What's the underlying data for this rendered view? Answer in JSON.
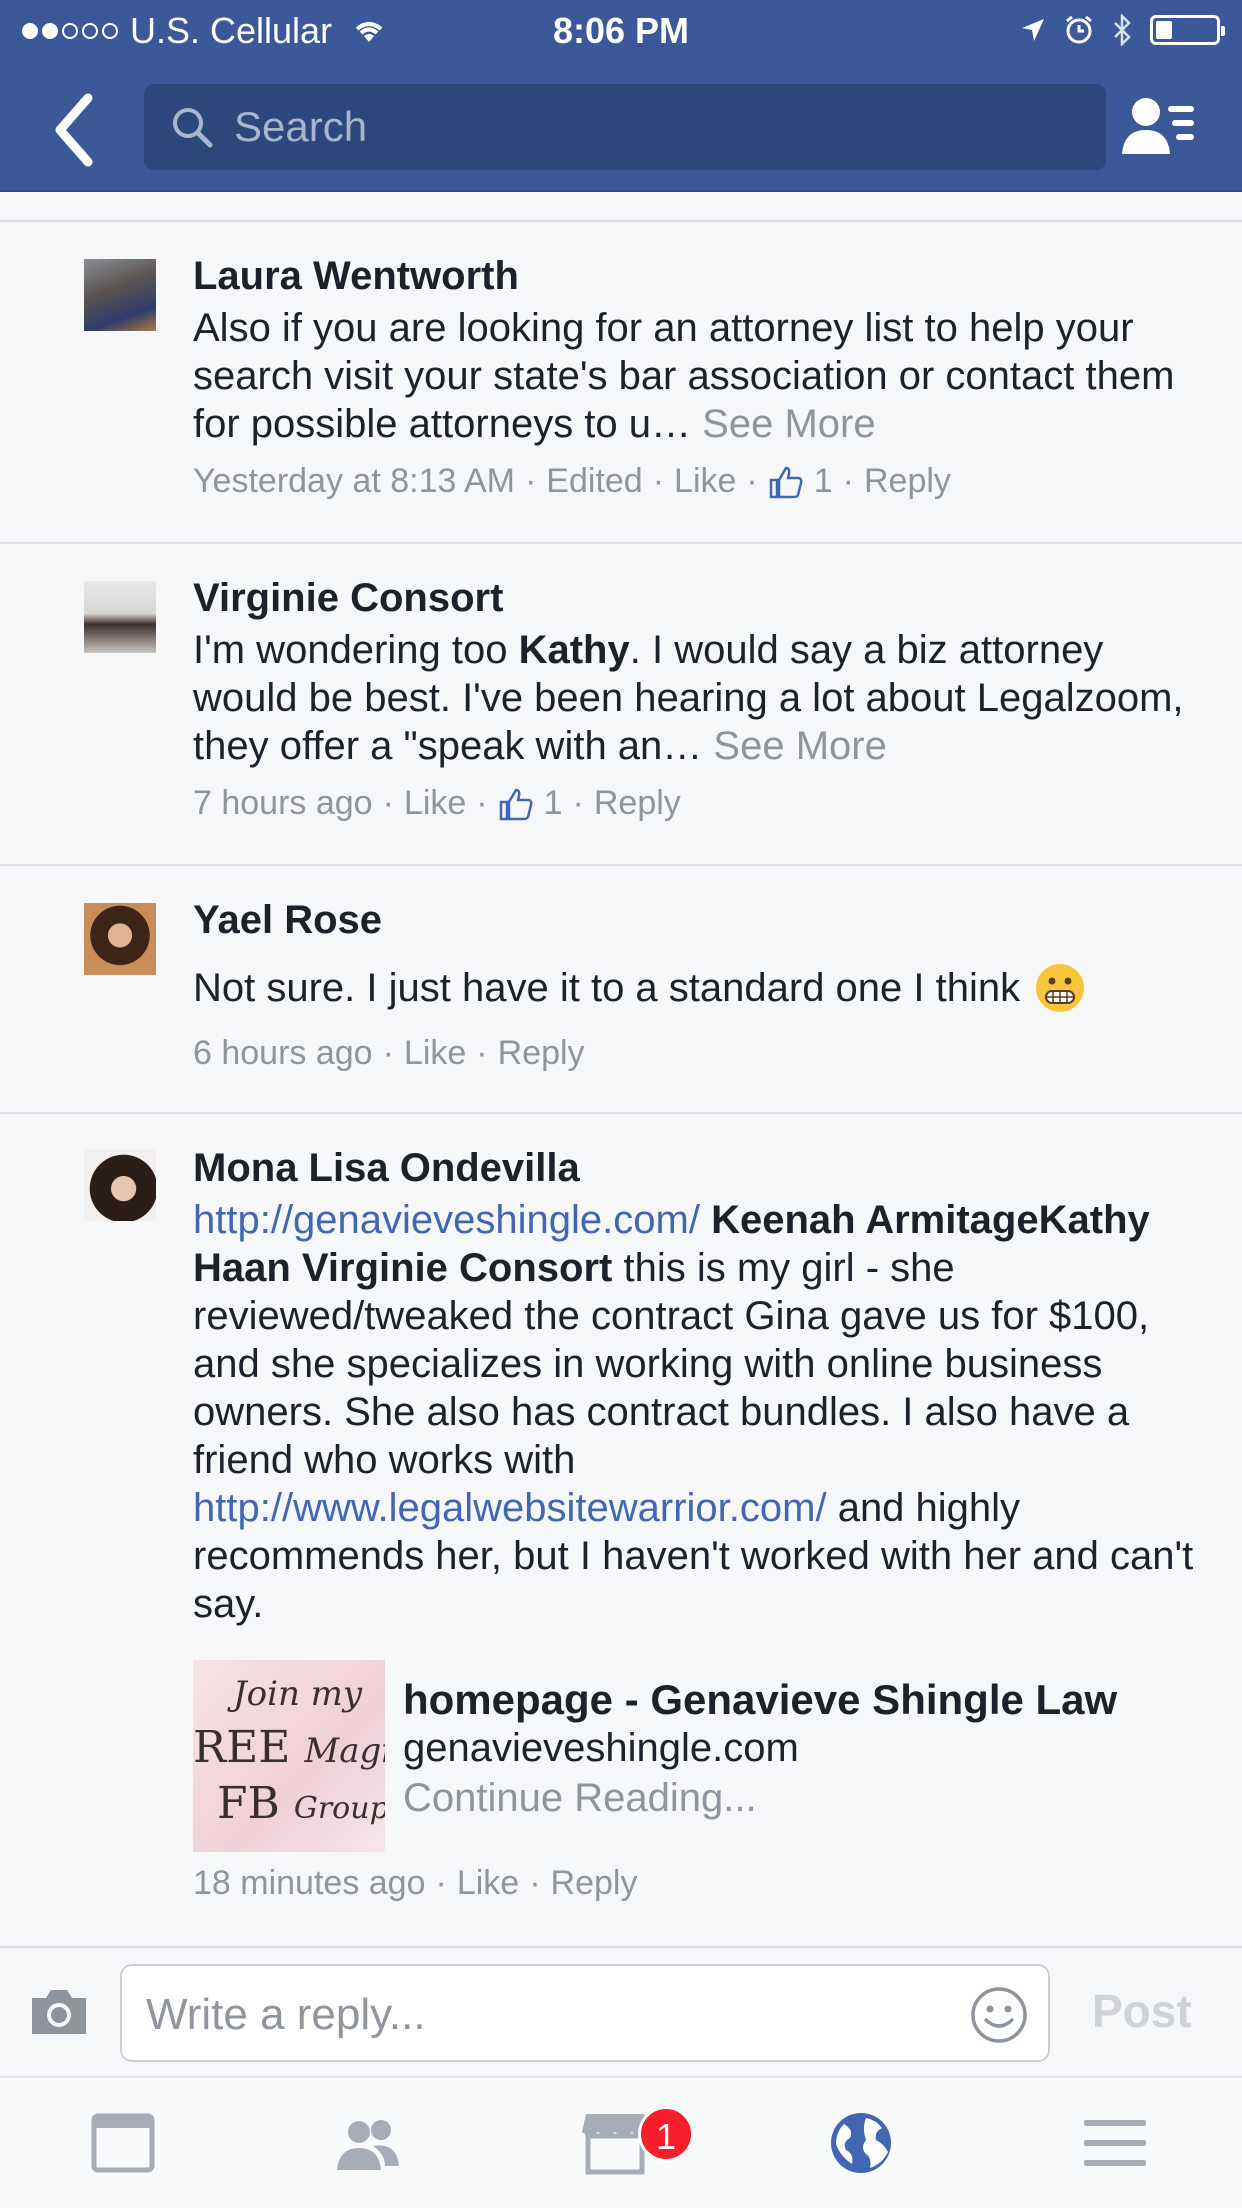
{
  "status_bar": {
    "carrier": "U.S. Cellular",
    "time": "8:06 PM",
    "signal_bars_filled": 2,
    "signal_bars_total": 5,
    "battery_level": 0.25
  },
  "header": {
    "search_placeholder": "Search",
    "back_icon": "chevron-left-icon",
    "friends_icon": "friend-list-icon",
    "color": "#3b5998"
  },
  "comments": [
    {
      "author": "Laura Wentworth",
      "text": "Also if you are looking for an attorney list to help your search visit your state's bar association or contact them for possible attorneys to u…",
      "see_more": "See More",
      "timestamp": "Yesterday at 8:13 AM",
      "edited": "Edited",
      "like": "Like",
      "likes": "1",
      "reply": "Reply"
    },
    {
      "author": "Virginie Consort",
      "text_prefix": "I'm wondering too ",
      "mention": "Kathy",
      "text_suffix": ". I would say a biz attorney would be best. I've been hearing a lot about Legalzoom, they offer a \"speak with an…",
      "see_more": "See More",
      "timestamp": "7 hours ago",
      "like": "Like",
      "likes": "1",
      "reply": "Reply"
    },
    {
      "author": "Yael Rose",
      "text": "Not sure. I just have it to a standard one I think",
      "emoji": "grimacing-emoji",
      "timestamp": "6 hours ago",
      "like": "Like",
      "reply": "Reply"
    },
    {
      "author": "Mona Lisa Ondevilla",
      "link1": "http://genavieveshingle.com/",
      "mentions": "Keenah ArmitageKathy Haan Virginie Consort",
      "text1": " this is my girl - she reviewed/tweaked the contract Gina gave us for $100, and she specializes in working with online business owners. She also has contract bundles. I also have a friend who works with ",
      "link2": "http://www.legalwebsitewarrior.com/",
      "text2": " and highly recommends her, but I haven't worked with her and can't say.",
      "preview": {
        "thumb_line1": "Join my",
        "thumb_line2": "REE",
        "thumb_line2b": "Magic",
        "thumb_line3": "FB",
        "thumb_line3b": "Group",
        "title": "homepage - Genavieve Shingle Law",
        "domain": "genavieveshingle.com",
        "continue": "Continue Reading..."
      },
      "timestamp": "18 minutes ago",
      "like": "Like",
      "reply": "Reply"
    }
  ],
  "reply_bar": {
    "placeholder": "Write a reply...",
    "post": "Post"
  },
  "tab_bar": {
    "tabs": [
      "news-feed-icon",
      "friends-icon",
      "marketplace-icon",
      "notifications-globe-icon",
      "menu-icon"
    ],
    "badge": "1",
    "active_color": "#4267b2"
  }
}
